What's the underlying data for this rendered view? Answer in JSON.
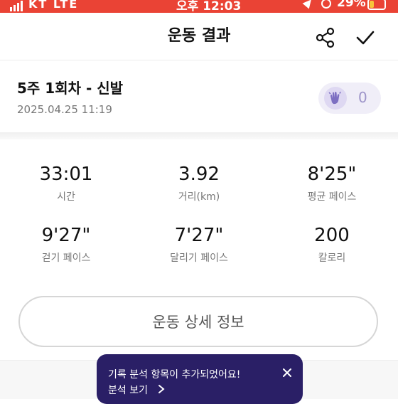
{
  "status_bar": {
    "carrier": "KT LTE",
    "time": "오후 12:03",
    "battery": "29%"
  },
  "header": {
    "title": "운동 결과"
  },
  "workout": {
    "title": "5주 1회차 - 신발",
    "date": "2025.04.25 11:19",
    "cheer_count": "0"
  },
  "stats": [
    {
      "value": "33:01",
      "label": "시간"
    },
    {
      "value": "3.92",
      "label": "거리(km)"
    },
    {
      "value": "8'25\"",
      "label": "평균 페이스"
    },
    {
      "value": "9'27\"",
      "label": "걷기 페이스"
    },
    {
      "value": "7'27\"",
      "label": "달리기 페이스"
    },
    {
      "value": "200",
      "label": "칼로리"
    }
  ],
  "detail_button": "운동 상세 정보",
  "tooltip": {
    "message": "기록 분석 항목이 추가되었어요!",
    "link": "분석 보기"
  },
  "colors": {
    "status_bar": "#ea4335",
    "tooltip_bg": "#2a1f66",
    "badge_bg": "#f0eef8"
  },
  "icons": [
    "share-icon",
    "check-icon",
    "clap-icon",
    "close-icon",
    "chevron-right-icon"
  ]
}
